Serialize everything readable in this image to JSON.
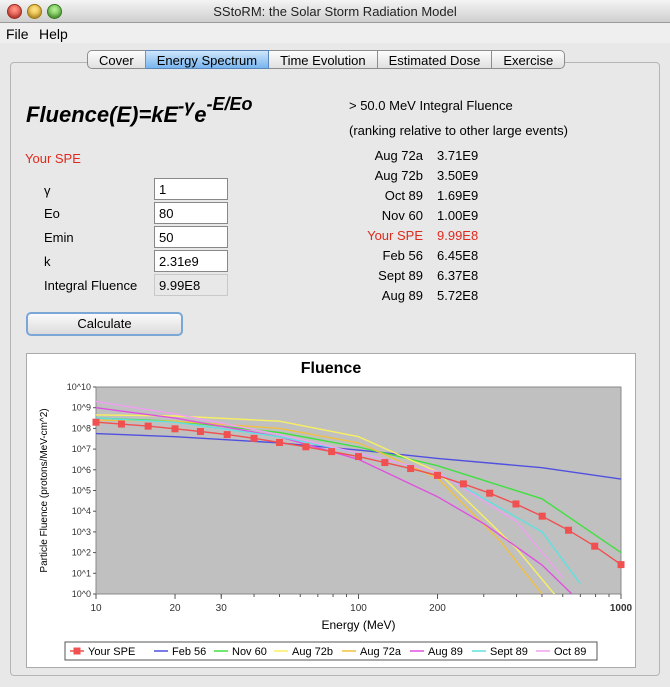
{
  "window": {
    "title": "SStoRM: the Solar Storm Radiation Model"
  },
  "menu": {
    "file": "File",
    "help": "Help"
  },
  "tabs": [
    {
      "label": "Cover",
      "active": false
    },
    {
      "label": "Energy Spectrum",
      "active": true
    },
    {
      "label": "Time Evolution",
      "active": false
    },
    {
      "label": "Estimated Dose",
      "active": false
    },
    {
      "label": "Exercise",
      "active": false
    }
  ],
  "formula": {
    "left": "Fluence(E)=kE",
    "exp1": "-γ",
    "mid": "e",
    "exp2": "-E/Eo"
  },
  "params": {
    "heading": "Your SPE",
    "gamma_label": "γ",
    "gamma_value": "1",
    "eo_label": "Eo",
    "eo_value": "80",
    "emin_label": "Emin",
    "emin_value": "50",
    "k_label": "k",
    "k_value": "2.31e9",
    "integral_label": "Integral Fluence",
    "integral_value": "9.99E8",
    "calculate_label": "Calculate"
  },
  "ranking": {
    "title": "> 50.0 MeV Integral Fluence",
    "subtitle": "(ranking relative to other large events)",
    "rows": [
      {
        "name": "Aug 72a",
        "value": "3.71E9",
        "highlight": false
      },
      {
        "name": "Aug 72b",
        "value": "3.50E9",
        "highlight": false
      },
      {
        "name": "Oct 89",
        "value": "1.69E9",
        "highlight": false
      },
      {
        "name": "Nov 60",
        "value": "1.00E9",
        "highlight": false
      },
      {
        "name": "Your SPE",
        "value": "9.99E8",
        "highlight": true
      },
      {
        "name": "Feb 56",
        "value": "6.45E8",
        "highlight": false
      },
      {
        "name": "Sept 89",
        "value": "6.37E8",
        "highlight": false
      },
      {
        "name": "Aug 89",
        "value": "5.72E8",
        "highlight": false
      }
    ]
  },
  "chart_data": {
    "type": "line",
    "title": "Fluence",
    "xlabel": "Energy (MeV)",
    "ylabel": "Particle Fluence (protons/MeV-cm^2)",
    "xscale": "log",
    "yscale": "log",
    "xlim": [
      10,
      1000
    ],
    "ylim_exp": [
      0,
      10
    ],
    "x_ticks": [
      "10",
      "20",
      "30",
      "100",
      "200",
      "1000"
    ],
    "x_tick_values": [
      10,
      20,
      30,
      100,
      200,
      1000
    ],
    "y_ticks": [
      "10^0",
      "10^1",
      "10^2",
      "10^3",
      "10^4",
      "10^5",
      "10^6",
      "10^7",
      "10^8",
      "10^9",
      "10^10"
    ],
    "legend_position": "bottom",
    "plot_background": "#c0c0c0",
    "series": [
      {
        "name": "Your SPE",
        "color": "#f05050",
        "markers": true,
        "x": [
          10,
          12.5,
          15.8,
          20,
          25,
          31.6,
          40,
          50,
          63,
          79,
          100,
          126,
          158,
          200,
          251,
          316,
          398,
          501,
          631,
          794,
          1000
        ],
        "y": [
          8.3,
          8.21,
          8.11,
          7.98,
          7.85,
          7.7,
          7.52,
          7.32,
          7.11,
          6.88,
          6.64,
          6.35,
          6.06,
          5.73,
          5.32,
          4.87,
          4.35,
          3.76,
          3.08,
          2.31,
          1.42
        ]
      },
      {
        "name": "Feb 56",
        "color": "#5050e0",
        "x": [
          10,
          20,
          50,
          100,
          200,
          500,
          1000
        ],
        "y": [
          7.75,
          7.6,
          7.3,
          6.95,
          6.55,
          6.1,
          5.55
        ]
      },
      {
        "name": "Nov 60",
        "color": "#40e040",
        "x": [
          10,
          20,
          50,
          100,
          200,
          500,
          1000
        ],
        "y": [
          8.5,
          8.35,
          7.8,
          7.1,
          6.2,
          4.6,
          2.0
        ]
      },
      {
        "name": "Aug 72b",
        "color": "#f8f060",
        "x": [
          10,
          20,
          50,
          100,
          200,
          400,
          600
        ],
        "y": [
          8.65,
          8.6,
          8.35,
          7.6,
          5.9,
          2.2,
          -0.5
        ]
      },
      {
        "name": "Aug 72a",
        "color": "#f0c040",
        "x": [
          10,
          20,
          50,
          100,
          200,
          350,
          500
        ],
        "y": [
          8.4,
          8.35,
          8.0,
          7.3,
          5.6,
          2.5,
          0.0
        ]
      },
      {
        "name": "Aug 89",
        "color": "#e050e0",
        "x": [
          10,
          20,
          50,
          100,
          200,
          300,
          500,
          650
        ],
        "y": [
          9.0,
          8.5,
          7.6,
          6.5,
          4.7,
          3.4,
          1.4,
          0.0
        ]
      },
      {
        "name": "Sept 89",
        "color": "#60e0e0",
        "x": [
          10,
          20,
          50,
          100,
          200,
          500,
          700
        ],
        "y": [
          8.5,
          8.3,
          7.6,
          6.8,
          5.9,
          3.0,
          0.5
        ]
      },
      {
        "name": "Oct 89",
        "color": "#f0a0f0",
        "x": [
          10,
          20,
          50,
          100,
          200,
          400,
          600
        ],
        "y": [
          9.3,
          8.7,
          7.7,
          6.8,
          5.9,
          3.5,
          0.8
        ]
      }
    ]
  }
}
